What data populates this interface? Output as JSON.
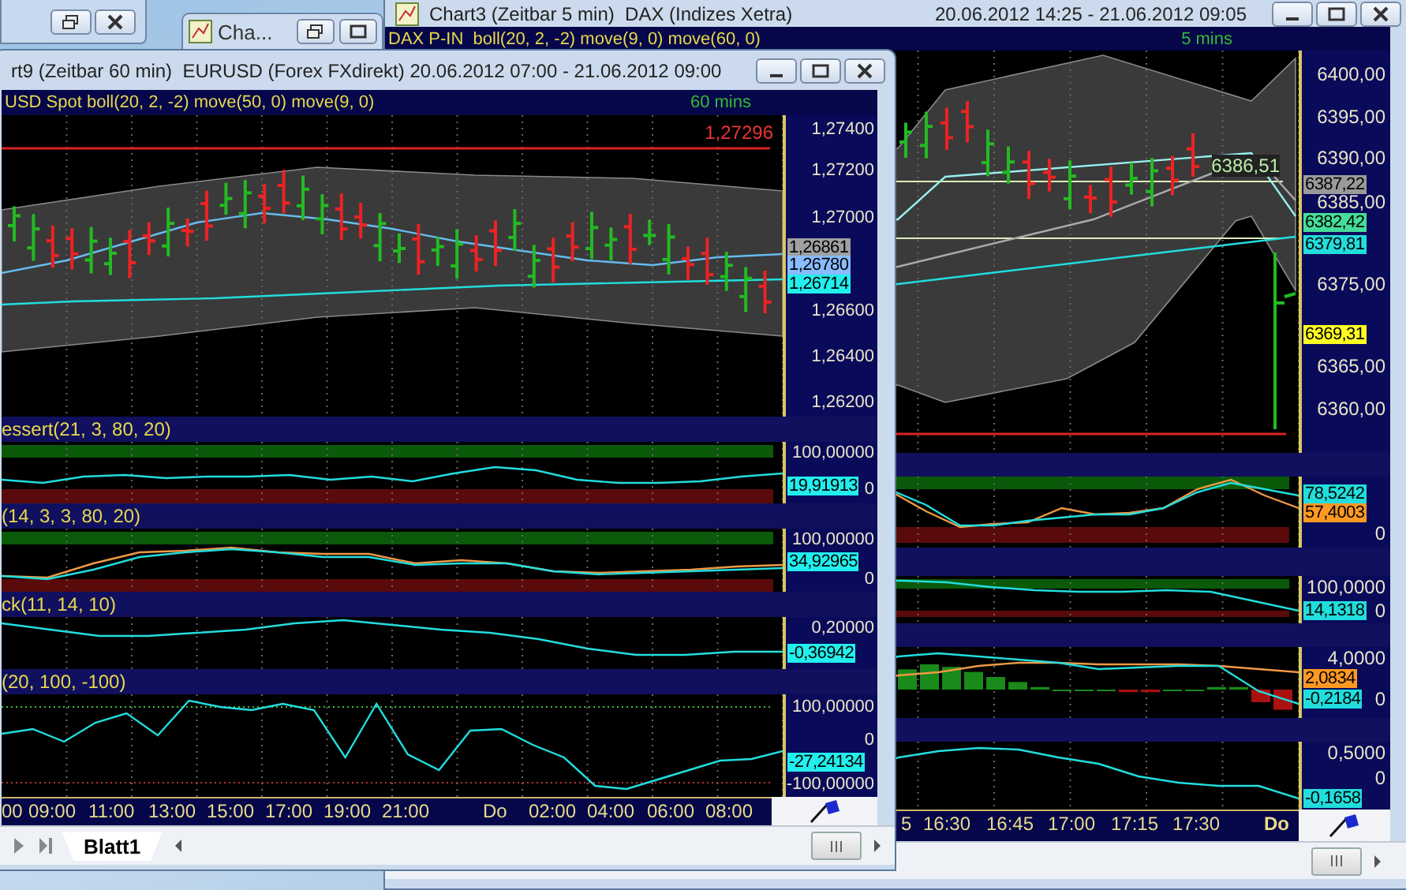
{
  "minimized_window": {
    "title": "Cha..."
  },
  "chart_windows": [
    {
      "kind": "back",
      "title": "Chart3 (Zeitbar 5 min)  DAX (Indizes Xetra)",
      "range": "20.06.2012 14:25 - 21.06.2012 09:05",
      "legend": "DAX P-IN  boll(20, 2, -2) move(9, 0) move(60, 0)",
      "interval": "5 mins",
      "price": {
        "ticks": [
          "6400,00",
          "6395,00",
          "6390,00",
          "6385,00",
          "6375,00",
          "6365,00",
          "6360,00"
        ],
        "plot_label": "6386,51",
        "labels": [
          {
            "text": "6387,22",
            "color": "#9a9a9a"
          },
          {
            "text": "6382,42",
            "color": "#44dd99"
          },
          {
            "text": "6379,81",
            "color": "#22dddd"
          },
          {
            "text": "6369,31",
            "color": "#ffff22"
          }
        ]
      },
      "panels": [
        {
          "ticks": [
            "0"
          ],
          "labels": [
            {
              "text": "78,5242",
              "color": "#22dddd"
            },
            {
              "text": "57,4003",
              "color": "#ff9922"
            }
          ]
        },
        {
          "ticks": [
            "100,0000",
            "0"
          ],
          "labels": [
            {
              "text": "14,1318",
              "color": "#22dddd"
            }
          ]
        },
        {
          "ticks": [
            "4,0000",
            "0"
          ],
          "labels": [
            {
              "text": "2,0834",
              "color": "#ff9922"
            },
            {
              "text": "-0,2184",
              "color": "#22dddd"
            }
          ]
        },
        {
          "ticks": [
            "0,5000",
            "0"
          ],
          "labels": [
            {
              "text": "-0,1658",
              "color": "#22dddd"
            }
          ]
        }
      ],
      "time_axis": [
        "5",
        "16:30",
        "16:45",
        "17:00",
        "17:15",
        "17:30",
        "Do"
      ]
    },
    {
      "kind": "front",
      "title": "rt9 (Zeitbar 60 min)  EURUSD (Forex FXdirekt) 20.06.2012 07:00 - 21.06.2012 09:00",
      "legend": "USD Spot boll(20, 2, -2) move(50, 0) move(9, 0)",
      "interval": "60 mins",
      "price": {
        "ticks": [
          "1,27400",
          "1,27200",
          "1,27000",
          "1,26600",
          "1,26400",
          "1,26200"
        ],
        "plot_label": "1,27296",
        "labels": [
          {
            "text": "1,26861",
            "color": "#a0a0a0"
          },
          {
            "text": "1,26780",
            "color": "#88bbff"
          },
          {
            "text": "1,26714",
            "color": "#22eeee"
          }
        ]
      },
      "panels": [
        {
          "legend": "essert(21, 3, 80, 20)",
          "ticks": [
            "100,00000",
            "0"
          ],
          "labels": [
            {
              "text": "19,91913",
              "color": "#22eeee"
            }
          ]
        },
        {
          "legend": "(14, 3, 3, 80, 20)",
          "ticks": [
            "100,00000",
            "0"
          ],
          "labels": [
            {
              "text": "34,92965",
              "color": "#22eeee"
            }
          ]
        },
        {
          "legend": "ck(11, 14, 10)",
          "ticks": [
            "0,20000"
          ],
          "labels": [
            {
              "text": "-0,36942",
              "color": "#22eeee"
            }
          ]
        },
        {
          "legend": "(20, 100, -100)",
          "ticks": [
            "100,00000",
            "0",
            "-100,00000"
          ],
          "labels": [
            {
              "text": "-27,24134",
              "color": "#22eeee"
            }
          ]
        }
      ],
      "time_axis": [
        "00",
        "09:00",
        "11:00",
        "13:00",
        "15:00",
        "17:00",
        "19:00",
        "21:00",
        "Do",
        "02:00",
        "04:00",
        "06:00",
        "08:00"
      ],
      "sheet_tabs": [
        {
          "label": "Blatt1",
          "selected": true
        }
      ]
    }
  ]
}
